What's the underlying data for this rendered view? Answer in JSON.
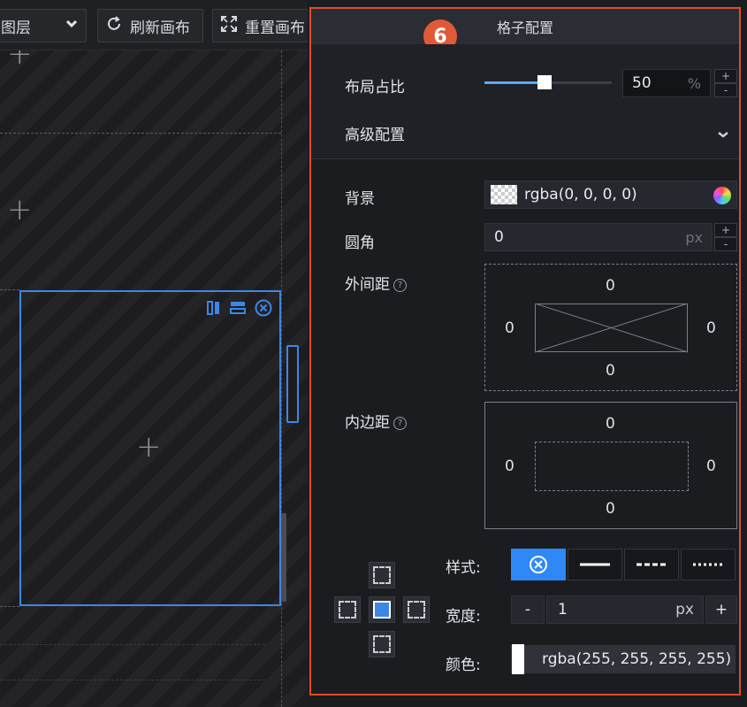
{
  "toolbar": {
    "layer_select_label": "图层",
    "refresh_label": "刷新画布",
    "reset_label": "重置画布"
  },
  "panel": {
    "title": "格子配置",
    "step_badge": "6",
    "layout_ratio": {
      "label": "布局占比",
      "value": "50",
      "unit": "%",
      "fraction": 0.5
    },
    "advanced_label": "高级配置",
    "background": {
      "label": "背景",
      "value": "rgba(0, 0, 0, 0)"
    },
    "radius": {
      "label": "圆角",
      "value": "0",
      "unit": "px"
    },
    "margin": {
      "label": "外间距",
      "top": "0",
      "right": "0",
      "bottom": "0",
      "left": "0"
    },
    "padding": {
      "label": "内边距",
      "top": "0",
      "right": "0",
      "bottom": "0",
      "left": "0"
    },
    "border": {
      "style_label": "样式:",
      "width_label": "宽度:",
      "width_value": "1",
      "width_unit": "px",
      "minus": "-",
      "plus": "+",
      "color_label": "颜色:",
      "color_value": "rgba(255, 255, 255, 255)"
    }
  },
  "colors": {
    "accent": "#2f88f5",
    "highlight": "#e04b2a",
    "badge": "#e05a37"
  }
}
